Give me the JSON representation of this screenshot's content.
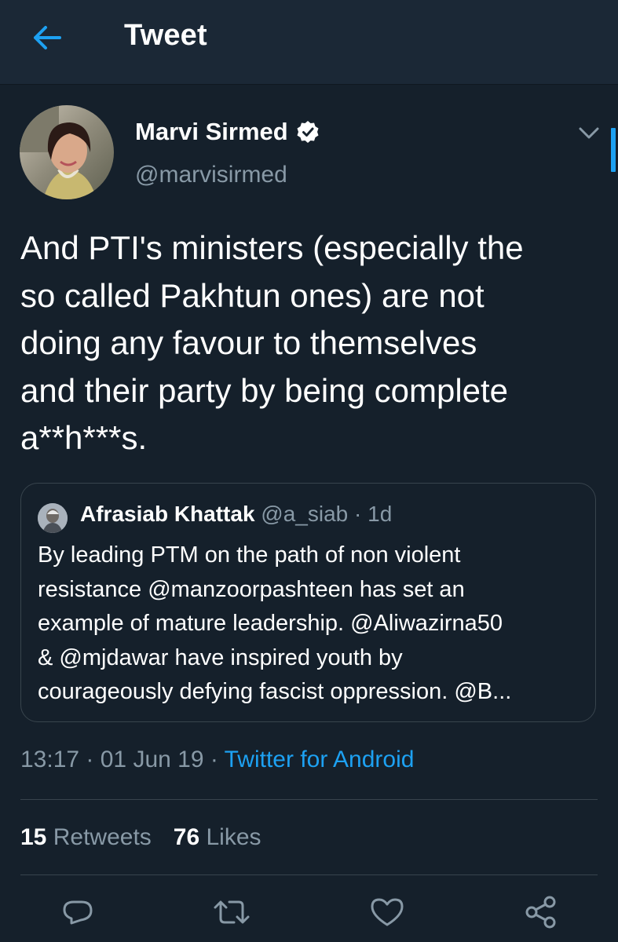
{
  "header": {
    "title": "Tweet",
    "back_icon": "arrow-left-icon",
    "accent_color": "#1da1f2"
  },
  "tweet": {
    "author": {
      "name": "Marvi Sirmed",
      "handle": "@marvisirmed",
      "verified": true
    },
    "text_lines": [
      "And PTI's ministers (especially the",
      "so called Pakhtun ones) are not",
      "doing any favour to themselves",
      "and their party by being complete",
      "a**h***s."
    ],
    "quoted": {
      "name": "Afrasiab Khattak",
      "handle": "@a_siab",
      "time": "· 1d",
      "text_lines": [
        "By leading PTM on the path of non violent",
        "resistance @manzoorpashteen has set an",
        "example of mature leadership. @Aliwazirna50",
        "& @mjdawar have inspired youth by",
        "courageously defying fascist oppression. @B..."
      ]
    },
    "time": "13:17 · 01 Jun 19 · ",
    "source": "Twitter for Android",
    "stats": {
      "retweets_count": "15",
      "retweets_label": "Retweets",
      "likes_count": "76",
      "likes_label": "Likes"
    }
  },
  "actions": [
    {
      "icon": "reply-icon"
    },
    {
      "icon": "retweet-icon"
    },
    {
      "icon": "like-icon"
    },
    {
      "icon": "share-icon"
    }
  ],
  "colors": {
    "background": "#15202b",
    "header_background": "#1b2836",
    "secondary_text": "#8899a6",
    "border": "#38444d"
  }
}
